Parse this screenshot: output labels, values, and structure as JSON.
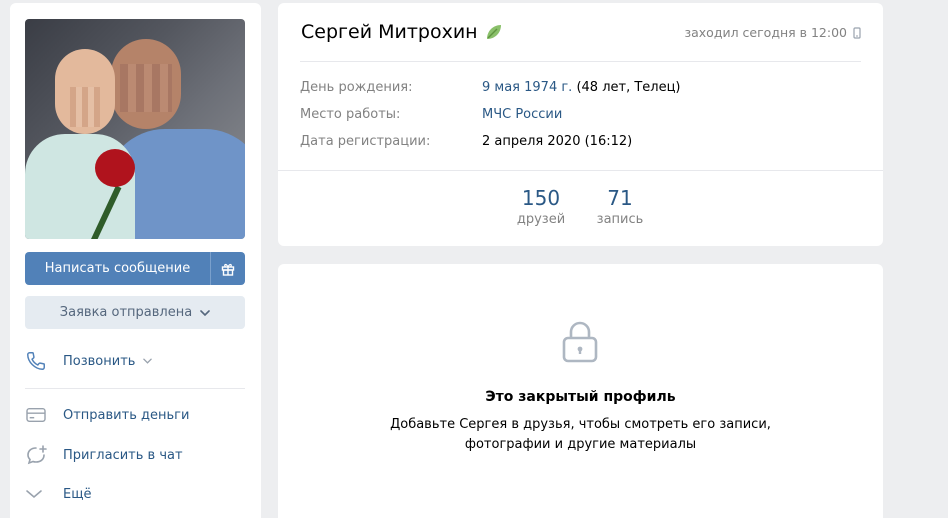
{
  "profile": {
    "name": "Сергей Митрохин",
    "last_seen": "заходил сегодня в 12:00"
  },
  "actions": {
    "write_message": "Написать сообщение",
    "request_sent": "Заявка отправлена",
    "call": "Позвонить",
    "send_money": "Отправить деньги",
    "invite_chat": "Пригласить в чат",
    "more": "Ещё"
  },
  "info": {
    "birthday": {
      "label": "День рождения:",
      "value_link": "9 мая 1974 г.",
      "value_extra": " (48 лет, Телец)"
    },
    "work": {
      "label": "Место работы:",
      "value": "МЧС России"
    },
    "registered": {
      "label": "Дата регистрации:",
      "value": "2 апреля 2020 (16:12)"
    }
  },
  "counters": {
    "friends": {
      "count": "150",
      "label": "друзей"
    },
    "posts": {
      "count": "71",
      "label": "запись"
    }
  },
  "closed_profile": {
    "title": "Это закрытый профиль",
    "line1": "Добавьте Сергея в друзья, чтобы смотреть его записи,",
    "line2": "фотографии и другие материалы"
  },
  "colors": {
    "accent": "#5181b8",
    "link": "#2a5885",
    "muted": "#828282",
    "background": "#edeef0"
  }
}
